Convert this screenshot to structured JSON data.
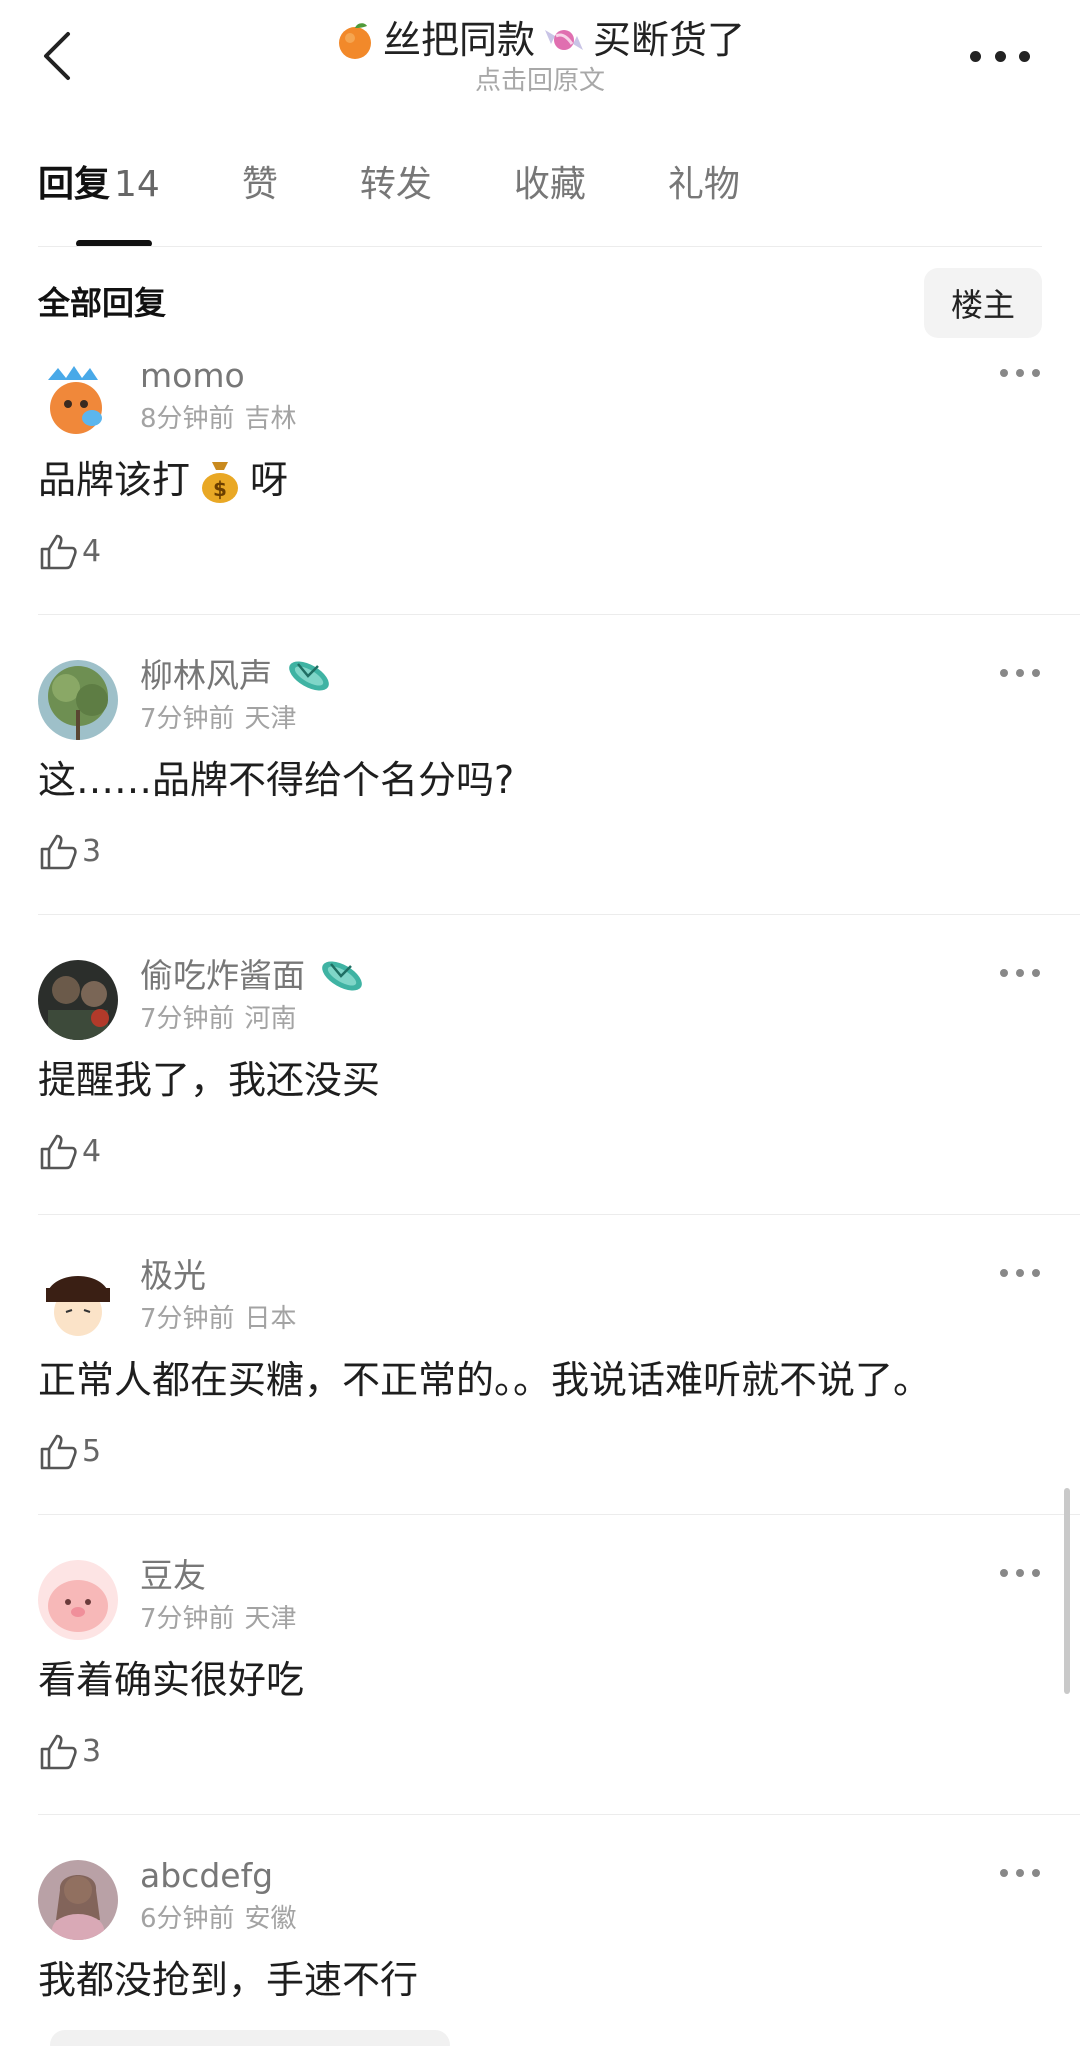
{
  "header": {
    "back_icon": "chevron-left-icon",
    "title": "丝把同款",
    "title_suffix": "买断货了",
    "subtitle": "点击回原文",
    "more_icon": "more-horizontal-icon"
  },
  "tabs": [
    {
      "label": "回复",
      "count": "14",
      "active": true
    },
    {
      "label": "赞"
    },
    {
      "label": "转发"
    },
    {
      "label": "收藏"
    },
    {
      "label": "礼物"
    }
  ],
  "section": {
    "title": "全部回复",
    "owner_button": "楼主"
  },
  "comments": [
    {
      "user": "momo",
      "time": "8分钟前",
      "location": "吉林",
      "text_before": "品牌该打",
      "text_after": "呀",
      "likes": "4",
      "badge": false
    },
    {
      "user": "柳林风声",
      "time": "7分钟前",
      "location": "天津",
      "text": "这……品牌不得给个名分吗?",
      "likes": "3",
      "badge": true
    },
    {
      "user": "偷吃炸酱面",
      "time": "7分钟前",
      "location": "河南",
      "text": "提醒我了，我还没买",
      "likes": "4",
      "badge": true
    },
    {
      "user": "极光",
      "time": "7分钟前",
      "location": "日本",
      "text": "正常人都在买糖，不正常的。。我说话难听就不说了。",
      "likes": "5",
      "badge": false
    },
    {
      "user": "豆友",
      "time": "7分钟前",
      "location": "天津",
      "text": "看着确实很好吃",
      "likes": "3",
      "badge": false
    },
    {
      "user": "abcdefg",
      "time": "6分钟前",
      "location": "安徽",
      "text": "我都没抢到，手速不行",
      "likes": "",
      "badge": false
    }
  ],
  "colors": {
    "text_primary": "#1e1e1e",
    "text_secondary": "#777777",
    "text_meta": "#a3a3a3",
    "divider": "#ececec",
    "badge_teal": "#3fb3a3"
  }
}
